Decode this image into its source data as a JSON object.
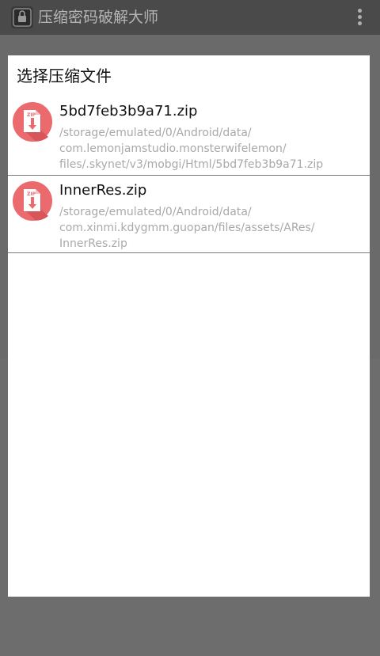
{
  "app": {
    "title": "压缩密码破解大师",
    "icon": "zip-lock-app-icon",
    "menu_icon": "overflow-menu-icon"
  },
  "dialog": {
    "title": "选择压缩文件",
    "files": [
      {
        "name": "5bd7feb3b9a71.zip",
        "icon": "zip-file-icon",
        "icon_label": "ZIP",
        "path_lines": [
          "/storage/emulated/0/Android/data/",
          "com.lemonjamstudio.monsterwifelemon/",
          "files/.skynet/v3/mobgi/Html/5bd7feb3b9a71.zip"
        ]
      },
      {
        "name": "InnerRes.zip",
        "icon": "zip-file-icon",
        "icon_label": "ZIP",
        "path_lines": [
          "/storage/emulated/0/Android/data/",
          "com.xinmi.kdygmm.guopan/files/assets/ARes/",
          "InnerRes.zip"
        ]
      }
    ]
  },
  "colors": {
    "scrim": "#6d6d6d",
    "dialog_bg": "#ffffff",
    "icon_circle": "#ea6a6e",
    "icon_shadow": "#d85559",
    "divider": "#7a7a7a",
    "path_text": "#a9a9a9",
    "primary_text": "#111111"
  }
}
